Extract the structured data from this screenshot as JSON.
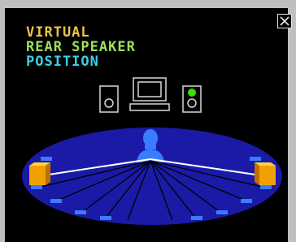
{
  "title": {
    "line1": "VIRTUAL",
    "line2": "REAR SPEAKER",
    "line3": "POSITION"
  },
  "colors": {
    "line1": "#e8c542",
    "line2": "#9ee05c",
    "line3": "#3ad0e8",
    "stage": "#1a1aa6",
    "speaker_marker": "#3a7cff",
    "active_indicator": "#39e000",
    "outline": "#d8d8d8"
  },
  "icons": {
    "close": "close-icon",
    "left_speaker": "front-left-speaker-icon",
    "right_speaker": "front-right-speaker-icon",
    "monitor": "monitor-icon",
    "listener": "listener-icon",
    "rear_left": "rear-left-speaker-icon",
    "rear_right": "rear-right-speaker-icon"
  }
}
